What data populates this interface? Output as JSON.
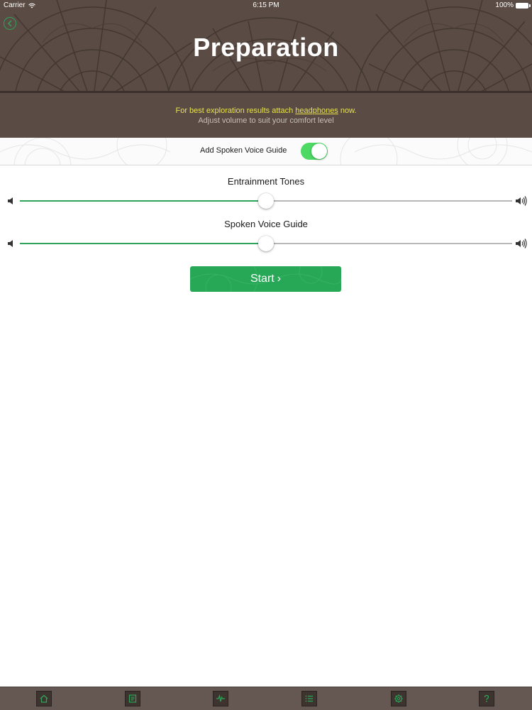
{
  "status_bar": {
    "carrier": "Carrier",
    "time": "6:15 PM",
    "battery": "100%"
  },
  "header": {
    "title": "Preparation",
    "back_icon": "chevron-left-circle-icon"
  },
  "info": {
    "line1_prefix": "For best exploration results attach ",
    "line1_link": "headphones",
    "line1_suffix": " now.",
    "line2": "Adjust volume to suit your comfort level"
  },
  "voice_toggle": {
    "label": "Add Spoken Voice Guide",
    "on": true
  },
  "sliders": [
    {
      "label": "Entrainment Tones",
      "value": 0.5
    },
    {
      "label": "Spoken Voice Guide",
      "value": 0.5
    }
  ],
  "start_button": {
    "label": "Start",
    "chevron": "›"
  },
  "tab_bar": {
    "icons": [
      "home-icon",
      "journal-icon",
      "waveform-icon",
      "list-icon",
      "gear-icon",
      "help-icon"
    ]
  },
  "colors": {
    "header_brown": "#5a4b44",
    "accent_green": "#2fa35a",
    "info_yellow": "#e8e34c"
  }
}
